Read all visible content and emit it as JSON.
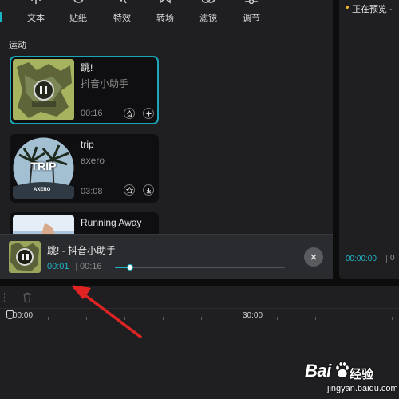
{
  "toolbar": {
    "tools": [
      {
        "label": "文本",
        "icon": "text-icon"
      },
      {
        "label": "贴纸",
        "icon": "sticker-icon"
      },
      {
        "label": "特效",
        "icon": "effects-icon"
      },
      {
        "label": "转场",
        "icon": "transition-icon"
      },
      {
        "label": "滤镜",
        "icon": "filter-icon"
      },
      {
        "label": "调节",
        "icon": "adjust-icon"
      }
    ]
  },
  "library": {
    "category": "运动",
    "cards": [
      {
        "title": "跳!",
        "artist": "抖音小助手",
        "duration": "00:16",
        "state": "playing",
        "actions": [
          "star-icon",
          "plus-icon"
        ]
      },
      {
        "title": "trip",
        "artist": "axero",
        "duration": "03:08",
        "cover_text": "TRIP",
        "cover_brand": "AXERO",
        "actions": [
          "star-icon",
          "download-icon"
        ]
      },
      {
        "title": "Running Away",
        "artist": "",
        "duration": ""
      }
    ]
  },
  "player": {
    "title": "跳!  - 抖音小助手",
    "current_time": "00:01",
    "separator": "|",
    "total_time": "00:16",
    "progress": 0.09
  },
  "preview": {
    "status": "正在预览 -",
    "time": "00:00:00",
    "time_separator": "|",
    "time_rest": "0"
  },
  "timeline": {
    "ruler_labels": [
      "00:00",
      "30:00"
    ]
  },
  "watermark": {
    "brand": "Bai",
    "brand_cn": "经验",
    "site": "jingyan.baidu.com"
  },
  "colors": {
    "accent": "#1aa7b8",
    "annotation_arrow": "#e02424",
    "preview_dot": "#f0b429"
  }
}
